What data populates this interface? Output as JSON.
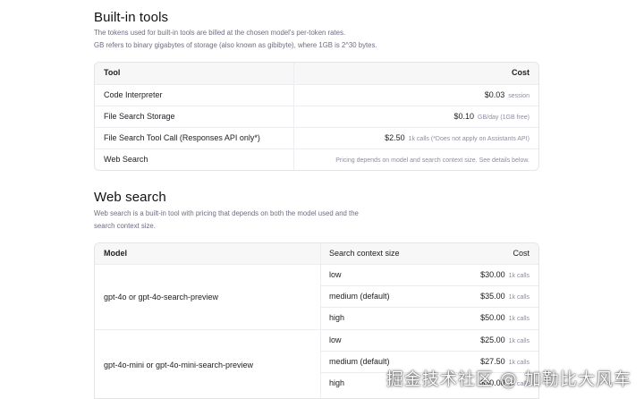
{
  "builtin": {
    "title": "Built-in tools",
    "desc_line1": "The tokens used for built-in tools are billed at the chosen model's per-token rates.",
    "desc_line2": "GB refers to binary gigabytes of storage (also known as gibibyte), where 1GB is 2^30 bytes.",
    "header": {
      "tool": "Tool",
      "cost": "Cost"
    },
    "rows": [
      {
        "name": "Code Interpreter",
        "price": "$0.03",
        "unit": "session"
      },
      {
        "name": "File Search Storage",
        "price": "$0.10",
        "unit": "GB/day (1GB free)"
      },
      {
        "name": "File Search Tool Call (Responses API only*)",
        "price": "$2.50",
        "unit": "1k calls (*Does not apply on Assistants API)"
      },
      {
        "name": "Web Search",
        "note": "Pricing depends on model and search context size. See details below."
      }
    ]
  },
  "websearch": {
    "title": "Web search",
    "desc_line1": "Web search is a built-in tool with pricing that depends on both the model used and the",
    "desc_line2": "search context size.",
    "header": {
      "model": "Model",
      "size": "Search context size",
      "cost": "Cost"
    },
    "groups": [
      {
        "model": "gpt-4o or gpt-4o-search-preview",
        "rows": [
          {
            "size": "low",
            "price": "$30.00",
            "unit": "1k calls"
          },
          {
            "size": "medium (default)",
            "price": "$35.00",
            "unit": "1k calls"
          },
          {
            "size": "high",
            "price": "$50.00",
            "unit": "1k calls"
          }
        ]
      },
      {
        "model": "gpt-4o-mini or gpt-4o-mini-search-preview",
        "rows": [
          {
            "size": "low",
            "price": "$25.00",
            "unit": "1k calls"
          },
          {
            "size": "medium (default)",
            "price": "$27.50",
            "unit": "1k calls"
          },
          {
            "size": "high",
            "price": "$30.00",
            "unit": "1k calls"
          }
        ]
      }
    ]
  },
  "watermark": "掘金技术社区 @ 加勒比大风车"
}
